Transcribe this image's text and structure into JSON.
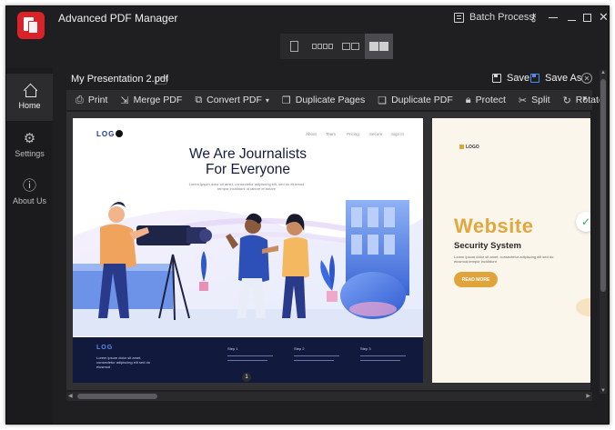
{
  "app": {
    "title": "Advanced PDF Manager",
    "batch_process_label": "Batch Process",
    "icons": {
      "logo": "pdf-manager-logo-icon",
      "key": "key-icon",
      "menu": "hamburger-menu-icon",
      "minimize": "minimize-icon",
      "maximize": "maximize-icon",
      "close": "close-icon"
    },
    "accent_color": "#d9222a"
  },
  "view_modes": [
    {
      "name": "single-page",
      "active": false
    },
    {
      "name": "grid-small",
      "active": false
    },
    {
      "name": "grid-medium",
      "active": false
    },
    {
      "name": "grid-large",
      "active": true
    }
  ],
  "sidebar": {
    "items": [
      {
        "label": "Home",
        "icon": "home-icon",
        "active": true
      },
      {
        "label": "Settings",
        "icon": "gear-icon",
        "active": false
      },
      {
        "label": "About Us",
        "icon": "info-icon",
        "active": false
      }
    ]
  },
  "document": {
    "file_name": "My Presentation 2.pdf",
    "save_label": "Save",
    "save_as_label": "Save As",
    "save_as_color": "#4b8df8"
  },
  "toolbar": {
    "print": "Print",
    "merge_pdf": "Merge PDF",
    "convert_pdf": "Convert PDF",
    "duplicate_pages": "Duplicate Pages",
    "duplicate_pdf": "Duplicate PDF",
    "protect": "Protect",
    "split": "Split",
    "rotate": "Rotate"
  },
  "pages": {
    "page1": {
      "logo": "LOG",
      "nav": [
        "About",
        "Team",
        "Pricing",
        "Secure",
        "Sign In"
      ],
      "heading_line1": "We Are Journalists",
      "heading_line2": "For Everyone",
      "subtext": "Lorem ipsum dolor sit amet, consectetur adipiscing elit, sed do eiusmod tempor incididunt ut labore et dolore",
      "footer_logo": "LOG",
      "footer_text": "Lorem ipsum dolor sit amet, consectetur adipiscing elit sed do eiusmod",
      "footer_steps": [
        "Step 1",
        "Step 2",
        "Step 3"
      ],
      "page_number": "1"
    },
    "page2": {
      "logo": "LOGO",
      "title": "Website",
      "subtitle": "Security System",
      "paragraph": "Lorem ipsum dolor sit amet, consectetur adipiscing elit sed do eiusmod tempor incididunt",
      "button": "READ MORE",
      "accent_color": "#e0a43a"
    }
  }
}
